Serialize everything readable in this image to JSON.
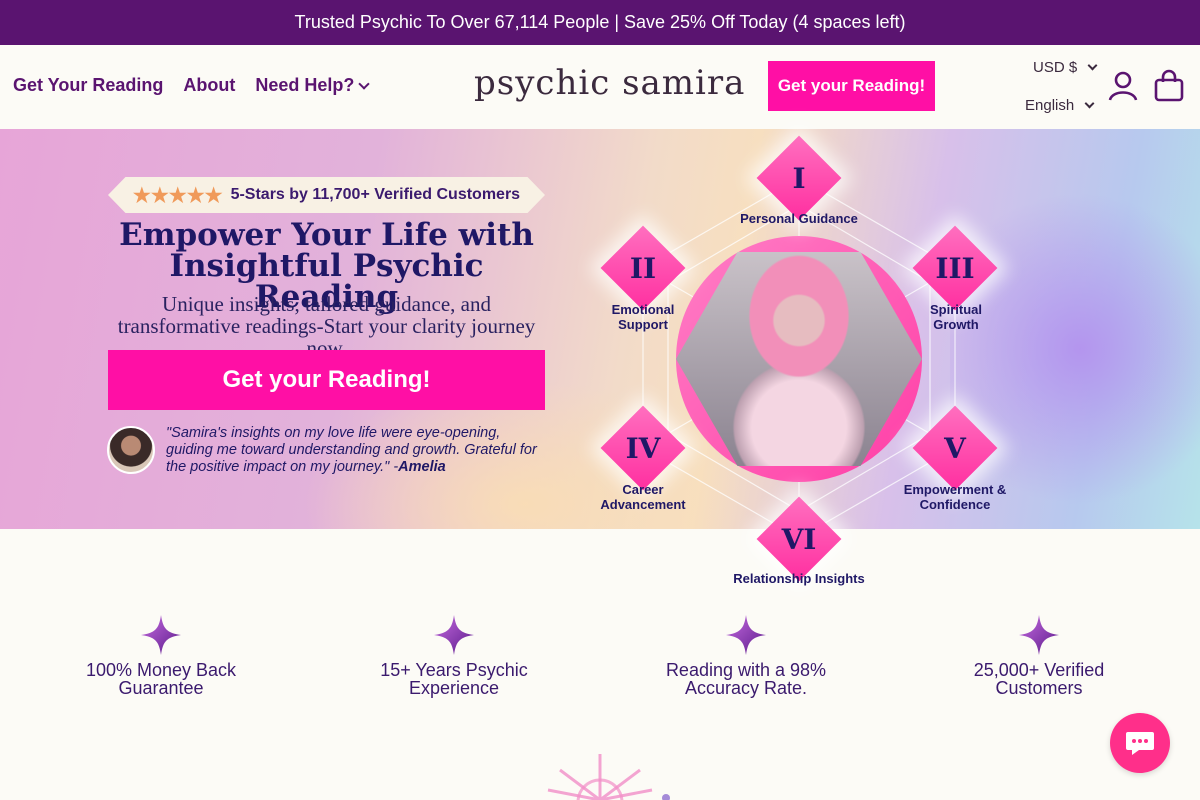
{
  "announcement": "Trusted Psychic To Over 67,114 People | Save 25% Off Today (4 spaces left)",
  "nav": {
    "reading": "Get Your Reading",
    "about": "About",
    "help": "Need Help?"
  },
  "logo": "psychic samira",
  "header_cta": "Get your Reading!",
  "currency": "USD $",
  "language": "English",
  "hero": {
    "stars_text": "5-Stars by 11,700+ Verified Customers",
    "stars_glyphs": "★★★★★",
    "title": "Empower Your Life with Insightful Psychic Reading",
    "subtitle": "Unique insights, tailored guidance, and transformative readings-Start your clarity journey now.",
    "cta": "Get your Reading!",
    "quote": "\"Samira's insights on my love life were eye-opening, guiding me toward understanding and growth. Grateful for the positive impact on my journey.\" -",
    "quote_author": "Amelia"
  },
  "wheel": [
    {
      "numeral": "I",
      "label": "Personal Guidance"
    },
    {
      "numeral": "II",
      "label": "Emotional Support"
    },
    {
      "numeral": "III",
      "label": "Spiritual Growth"
    },
    {
      "numeral": "IV",
      "label": "Career Advancement"
    },
    {
      "numeral": "V",
      "label": "Empowerment & Confidence"
    },
    {
      "numeral": "VI",
      "label": "Relationship Insights"
    }
  ],
  "features": [
    "100% Money Back Guarantee",
    "15+ Years Psychic Experience",
    "Reading with a 98% Accuracy Rate.",
    "25,000+ Verified Customers"
  ],
  "icons": {
    "account": "user-icon",
    "cart": "bag-icon",
    "chat": "chat-icon",
    "feature": "sparkle-icon"
  },
  "colors": {
    "brand_purple": "#5a1470",
    "cta_pink": "#ff0fa5",
    "title_navy": "#1f1866"
  }
}
